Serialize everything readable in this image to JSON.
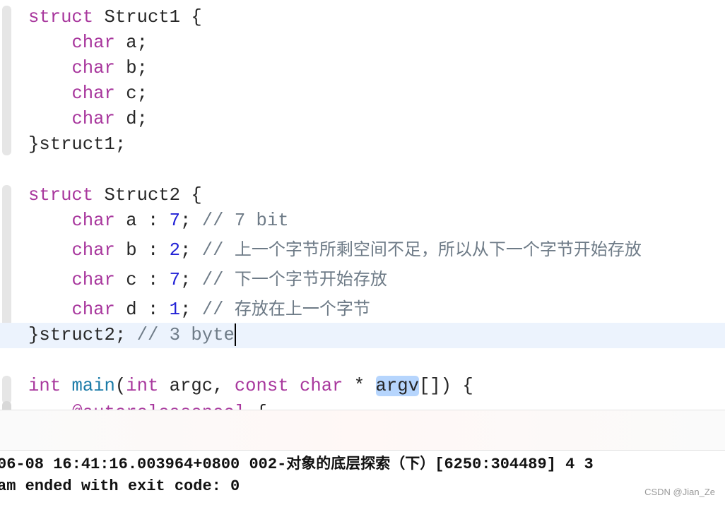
{
  "colors": {
    "keyword": "#a8379d",
    "function": "#1b7ba8",
    "number": "#2222d6",
    "comment": "#6e7b87",
    "plain": "#262626",
    "current_line": "#ecf3fd",
    "selection": "#b6d5fd"
  },
  "editor": {
    "lines": [
      [
        {
          "t": "struct",
          "k": "keyword"
        },
        {
          "t": " Struct1 {",
          "k": "plain"
        }
      ],
      [
        {
          "t": "    ",
          "k": "plain"
        },
        {
          "t": "char",
          "k": "keyword"
        },
        {
          "t": " a;",
          "k": "plain"
        }
      ],
      [
        {
          "t": "    ",
          "k": "plain"
        },
        {
          "t": "char",
          "k": "keyword"
        },
        {
          "t": " b;",
          "k": "plain"
        }
      ],
      [
        {
          "t": "    ",
          "k": "plain"
        },
        {
          "t": "char",
          "k": "keyword"
        },
        {
          "t": " c;",
          "k": "plain"
        }
      ],
      [
        {
          "t": "    ",
          "k": "plain"
        },
        {
          "t": "char",
          "k": "keyword"
        },
        {
          "t": " d;",
          "k": "plain"
        }
      ],
      [
        {
          "t": "}struct1;",
          "k": "plain"
        }
      ],
      [],
      [
        {
          "t": "struct",
          "k": "keyword"
        },
        {
          "t": " Struct2 {",
          "k": "plain"
        }
      ],
      [
        {
          "t": "    ",
          "k": "plain"
        },
        {
          "t": "char",
          "k": "keyword"
        },
        {
          "t": " a : ",
          "k": "plain"
        },
        {
          "t": "7",
          "k": "number"
        },
        {
          "t": "; ",
          "k": "plain"
        },
        {
          "t": "// 7 bit",
          "k": "comment"
        }
      ],
      [
        {
          "t": "    ",
          "k": "plain"
        },
        {
          "t": "char",
          "k": "keyword"
        },
        {
          "t": " b : ",
          "k": "plain"
        },
        {
          "t": "2",
          "k": "number"
        },
        {
          "t": "; ",
          "k": "plain"
        },
        {
          "t": "// ",
          "k": "comment"
        },
        {
          "t": "上一个字节所剩空间不足，所以从下一个字节开始存放",
          "k": "comment-cjk"
        }
      ],
      [
        {
          "t": "    ",
          "k": "plain"
        },
        {
          "t": "char",
          "k": "keyword"
        },
        {
          "t": " c : ",
          "k": "plain"
        },
        {
          "t": "7",
          "k": "number"
        },
        {
          "t": "; ",
          "k": "plain"
        },
        {
          "t": "// ",
          "k": "comment"
        },
        {
          "t": "下一个字节开始存放",
          "k": "comment-cjk"
        }
      ],
      [
        {
          "t": "    ",
          "k": "plain"
        },
        {
          "t": "char",
          "k": "keyword"
        },
        {
          "t": " d : ",
          "k": "plain"
        },
        {
          "t": "1",
          "k": "number"
        },
        {
          "t": "; ",
          "k": "plain"
        },
        {
          "t": "// ",
          "k": "comment"
        },
        {
          "t": "存放在上一个字节",
          "k": "comment-cjk"
        }
      ],
      [
        {
          "t": "}struct2; ",
          "k": "plain"
        },
        {
          "t": "// 3 byte",
          "k": "comment"
        },
        {
          "t": "",
          "k": "caret"
        }
      ],
      [],
      [
        {
          "t": "int",
          "k": "keyword"
        },
        {
          "t": " ",
          "k": "plain"
        },
        {
          "t": "main",
          "k": "func"
        },
        {
          "t": "(",
          "k": "plain"
        },
        {
          "t": "int",
          "k": "keyword"
        },
        {
          "t": " argc, ",
          "k": "plain"
        },
        {
          "t": "const",
          "k": "keyword"
        },
        {
          "t": " ",
          "k": "plain"
        },
        {
          "t": "char",
          "k": "keyword"
        },
        {
          "t": " * ",
          "k": "plain"
        },
        {
          "t": "argv",
          "k": "selected"
        },
        {
          "t": "[]) {",
          "k": "plain"
        }
      ],
      [
        {
          "t": "    ",
          "k": "plain"
        },
        {
          "t": "@autoreleasepool",
          "k": "keyword"
        },
        {
          "t": " {",
          "k": "plain"
        }
      ]
    ]
  },
  "console": {
    "output": [
      [
        {
          "t": "06-08 16:41:16.003964+0800 002-",
          "k": "plain"
        },
        {
          "t": "对象的底层探索（下）",
          "k": "cjk"
        },
        {
          "t": "[6250:304489] 4 3",
          "k": "plain"
        }
      ],
      [
        {
          "t": "am ended with exit code: 0",
          "k": "plain"
        }
      ]
    ]
  },
  "watermark": "CSDN @Jian_Ze"
}
